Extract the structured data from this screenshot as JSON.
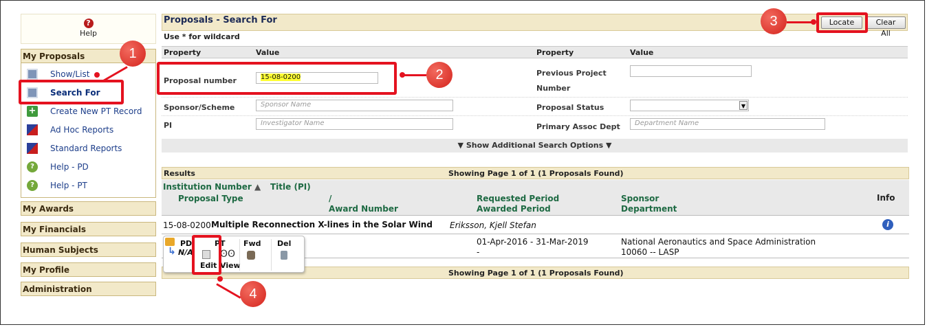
{
  "sidebar": {
    "help_label": "Help",
    "my_proposals": "My Proposals",
    "items": [
      {
        "label": "Show/List",
        "icon": "document-list-icon"
      },
      {
        "label": "Search For",
        "icon": "document-search-icon"
      },
      {
        "label": "Create New PT Record",
        "icon": "add-record-icon"
      },
      {
        "label": "Ad Hoc Reports",
        "icon": "chart-icon"
      },
      {
        "label": "Standard Reports",
        "icon": "chart-icon"
      },
      {
        "label": "Help - PD",
        "icon": "help-icon"
      },
      {
        "label": "Help - PT",
        "icon": "help-icon"
      }
    ],
    "sections": [
      "My Awards",
      "My Financials",
      "Human Subjects",
      "My Profile",
      "Administration"
    ]
  },
  "search": {
    "title": "Proposals - Search For",
    "wildcard_note": "Use * for wildcard",
    "locate_label": "Locate",
    "clear_label": "Clear All",
    "property_header": "Property",
    "value_header": "Value",
    "fields": {
      "proposal_number_label": "Proposal number",
      "proposal_number_value": "15-08-0200",
      "previous_project_label_1": "Previous Project",
      "previous_project_label_2": "Number",
      "sponsor_label": "Sponsor/Scheme",
      "sponsor_placeholder": "Sponsor Name",
      "status_label": "Proposal Status",
      "pi_label": "PI",
      "pi_placeholder": "Investigator Name",
      "dept_label": "Primary Assoc Dept",
      "dept_placeholder": "Department Name"
    },
    "more_options": "Show Additional Search Options"
  },
  "results": {
    "label": "Results",
    "page_info": "Showing Page 1 of 1 (1 Proposals Found)",
    "headers": {
      "institution_number": "Institution Number",
      "title_pi": "Title (PI)",
      "proposal_type": "Proposal Type",
      "slash": "/",
      "award_number": "Award Number",
      "requested_period": "Requested Period",
      "awarded_period": "Awarded Period",
      "sponsor": "Sponsor",
      "department": "Department",
      "info": "Info"
    },
    "row": {
      "number": "15-08-0200",
      "title": "Multiple Reconnection X-lines in the Solar Wind",
      "pi": "Eriksson, Kjell Stefan",
      "period": "01-Apr-2016 - 31-Mar-2019",
      "awarded": "-",
      "sponsor": "National Aeronautics and Space Administration",
      "department": "10060 -- LASP",
      "type_partial": "N/A"
    },
    "actions": [
      {
        "top": "PD",
        "bottom": ""
      },
      {
        "top": "PT",
        "bottom": "Edit"
      },
      {
        "top": "",
        "bottom": "View"
      },
      {
        "top": "Fwd",
        "bottom": ""
      },
      {
        "top": "Del",
        "bottom": ""
      }
    ]
  },
  "callouts": [
    "1",
    "2",
    "3",
    "4"
  ],
  "colors": {
    "highlight": "#e4121f",
    "header_bg": "#f2e9c9",
    "link": "#1d3e8a",
    "green_header": "#1e6a43"
  }
}
